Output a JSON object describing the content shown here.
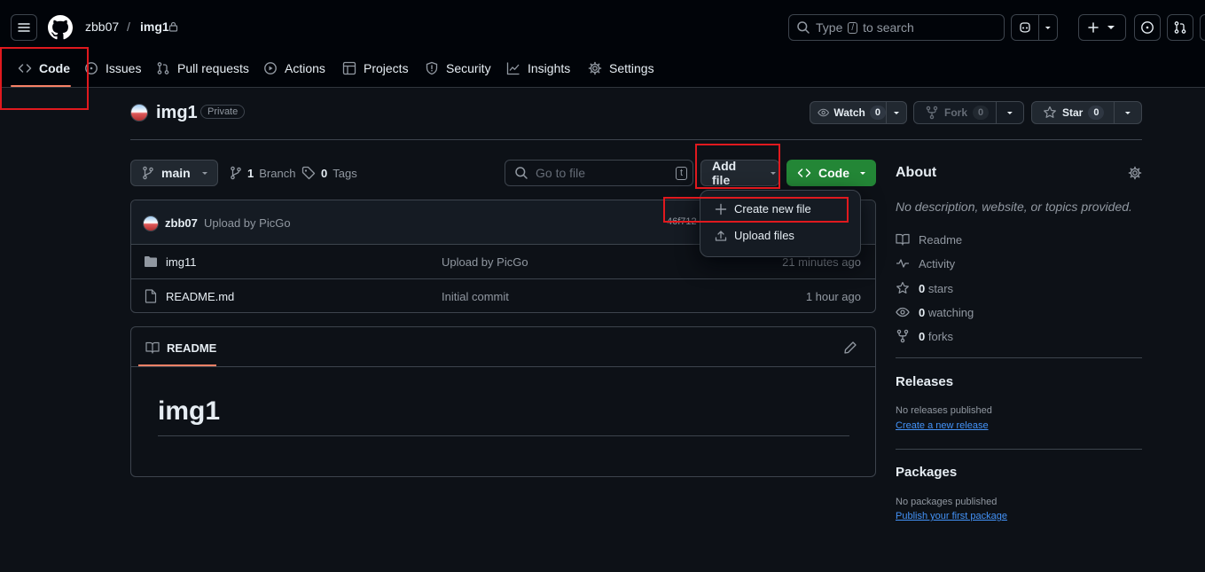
{
  "header": {
    "owner": "zbb07",
    "separator": "/",
    "repo": "img1",
    "search": {
      "prefix": "Type",
      "key": "/",
      "suffix": "to search"
    }
  },
  "tabs": [
    {
      "label": "Code",
      "icon": "code-icon",
      "selected": true
    },
    {
      "label": "Issues",
      "icon": "issue-icon"
    },
    {
      "label": "Pull requests",
      "icon": "pull-request-icon"
    },
    {
      "label": "Actions",
      "icon": "play-icon"
    },
    {
      "label": "Projects",
      "icon": "table-icon"
    },
    {
      "label": "Security",
      "icon": "shield-icon"
    },
    {
      "label": "Insights",
      "icon": "graph-icon"
    },
    {
      "label": "Settings",
      "icon": "gear-icon"
    }
  ],
  "repo": {
    "name": "img1",
    "visibility": "Private",
    "watch": {
      "label": "Watch",
      "count": "0"
    },
    "fork": {
      "label": "Fork",
      "count": "0"
    },
    "star": {
      "label": "Star",
      "count": "0"
    }
  },
  "toolbar": {
    "branch": "main",
    "branches": {
      "count": "1",
      "label": "Branch"
    },
    "tags": {
      "count": "0",
      "label": "Tags"
    },
    "go_to_file_placeholder": "Go to file",
    "go_to_file_key": "t",
    "add_file": "Add file",
    "code": "Code"
  },
  "menu": {
    "items": [
      {
        "label": "Create new file",
        "icon": "plus-icon"
      },
      {
        "label": "Upload files",
        "icon": "upload-icon"
      }
    ]
  },
  "commit": {
    "author": "zbb07",
    "message": "Upload by PicGo",
    "hash_fragment": "46f712"
  },
  "files": [
    {
      "name": "img11",
      "type": "folder",
      "message": "Upload by PicGo",
      "time": "21 minutes ago"
    },
    {
      "name": "README.md",
      "type": "file",
      "message": "Initial commit",
      "time": "1 hour ago"
    }
  ],
  "readme": {
    "tab_label": "README",
    "heading": "img1"
  },
  "about": {
    "title": "About",
    "description": "No description, website, or topics provided.",
    "items": [
      {
        "icon": "book-icon",
        "count": "",
        "label": "Readme"
      },
      {
        "icon": "pulse-icon",
        "count": "",
        "label": "Activity"
      },
      {
        "icon": "star-icon",
        "count": "0",
        "label": "stars"
      },
      {
        "icon": "eye-icon",
        "count": "0",
        "label": "watching"
      },
      {
        "icon": "fork-icon",
        "count": "0",
        "label": "forks"
      }
    ]
  },
  "releases": {
    "title": "Releases",
    "empty": "No releases published",
    "link": "Create a new release"
  },
  "packages": {
    "title": "Packages",
    "empty": "No packages published",
    "link": "Publish your first package"
  },
  "colors": {
    "background": "#0d1117",
    "header_background": "#010409",
    "border": "#3d444d",
    "accent_green": "#238636",
    "link": "#4493f8",
    "tab_underline": "#f78166",
    "annotation_red": "#e0191e"
  }
}
